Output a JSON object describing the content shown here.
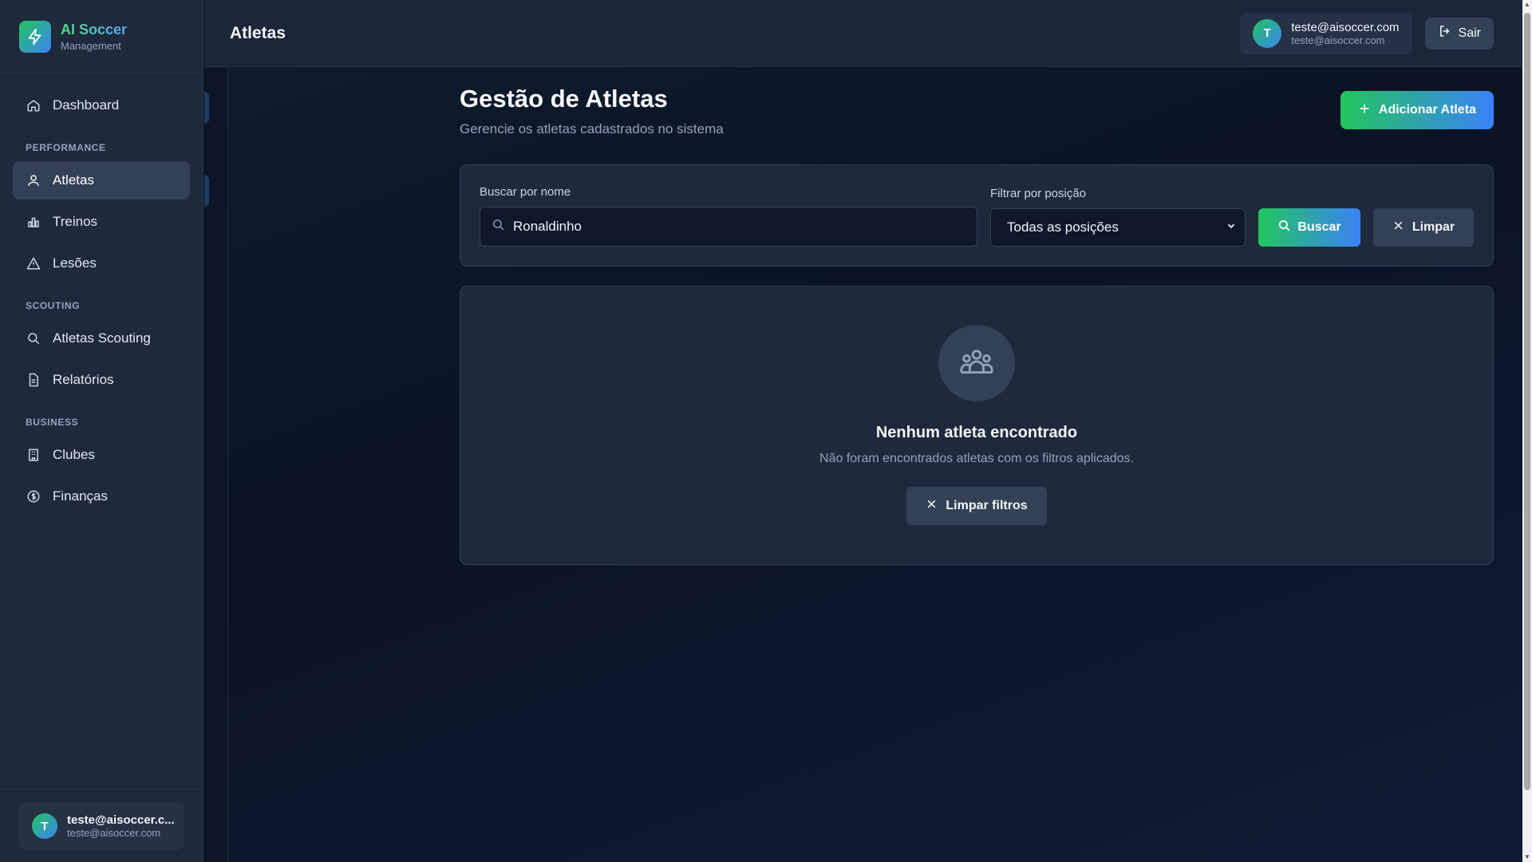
{
  "brand": {
    "title": "AI Soccer",
    "subtitle": "Management"
  },
  "sidebar": {
    "items": [
      {
        "label": "Dashboard",
        "icon": "home-icon"
      },
      {
        "section": "PERFORMANCE"
      },
      {
        "label": "Atletas",
        "icon": "user-icon",
        "active": true
      },
      {
        "label": "Treinos",
        "icon": "bar-chart-icon"
      },
      {
        "label": "Lesões",
        "icon": "warning-icon"
      },
      {
        "section": "SCOUTING"
      },
      {
        "label": "Atletas Scouting",
        "icon": "search-icon"
      },
      {
        "label": "Relatórios",
        "icon": "document-icon"
      },
      {
        "section": "BUSINESS"
      },
      {
        "label": "Clubes",
        "icon": "building-icon"
      },
      {
        "label": "Finanças",
        "icon": "dollar-icon"
      }
    ],
    "user": {
      "initial": "T",
      "name": "teste@aisoccer.c...",
      "email": "teste@aisoccer.com"
    }
  },
  "topbar": {
    "title": "Atletas",
    "user": {
      "initial": "T",
      "name": "teste@aisoccer.com",
      "email": "teste@aisoccer.com"
    },
    "logout_label": "Sair"
  },
  "page": {
    "title": "Gestão de Atletas",
    "subtitle": "Gerencie os atletas cadastrados no sistema",
    "add_label": "Adicionar Atleta"
  },
  "filters": {
    "search_label": "Buscar por nome",
    "search_value": "Ronaldinho",
    "position_label": "Filtrar por posição",
    "position_selected": "Todas as posições",
    "search_button": "Buscar",
    "clear_button": "Limpar"
  },
  "empty": {
    "title": "Nenhum atleta encontrado",
    "text": "Não foram encontrados atletas com os filtros aplicados.",
    "button": "Limpar filtros"
  },
  "colors": {
    "accent_green": "#22c55e",
    "accent_blue": "#3b82f6",
    "sidebar_bg": "#1e293b",
    "active_bg": "#334155"
  }
}
